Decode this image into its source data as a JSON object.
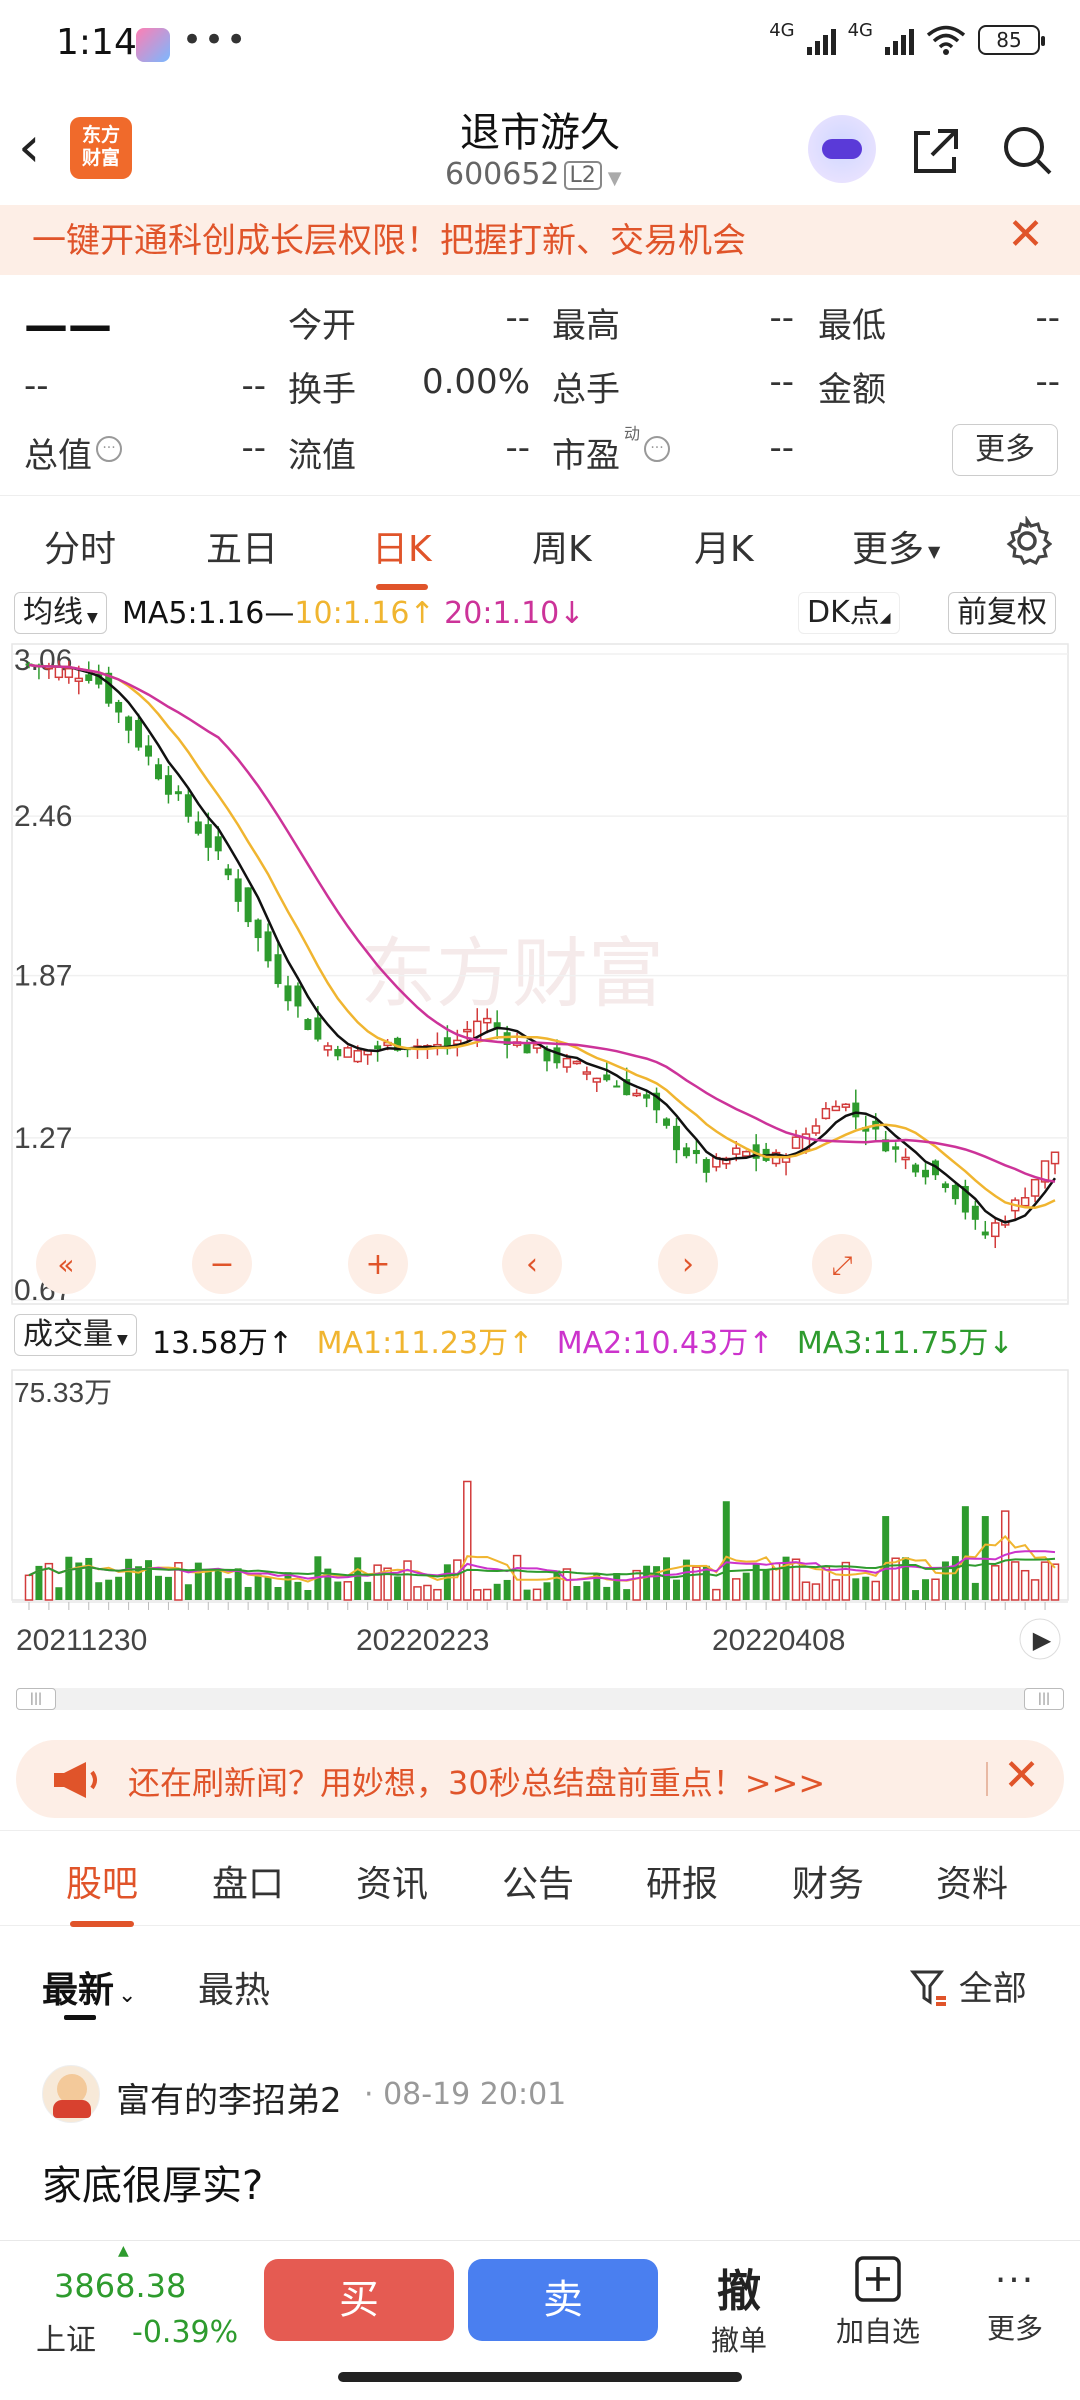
{
  "status_bar": {
    "time": "1:14",
    "dots": "•••",
    "net1": "4G",
    "net2": "4G",
    "battery": "85"
  },
  "header": {
    "title": "退市游久",
    "code": "600652",
    "level": "L2",
    "logo_line1": "东方",
    "logo_line2": "财富"
  },
  "banner": {
    "text": "一键开通科创成长层权限！把握打新、交易机会",
    "close": "✕"
  },
  "quote": {
    "price": "——",
    "change": "--",
    "change_pct": "--",
    "rows": [
      [
        {
          "label": "今开",
          "value": "--"
        },
        {
          "label": "最高",
          "value": "--"
        },
        {
          "label": "最低",
          "value": "--"
        }
      ],
      [
        {
          "label": "换手",
          "value": "0.00%"
        },
        {
          "label": "总手",
          "value": "--"
        },
        {
          "label": "金额",
          "value": "--"
        }
      ],
      [
        {
          "label": "流值",
          "value": "--"
        },
        {
          "label": "市盈",
          "value": "--"
        }
      ]
    ],
    "total_value_label": "总值",
    "total_value": "--",
    "pe_sup": "动",
    "more": "更多"
  },
  "chart_tabs": [
    "分时",
    "五日",
    "日K",
    "周K",
    "月K",
    "更多"
  ],
  "chart_controls": {
    "ma_selector": "均线",
    "ma5": "MA5:1.16",
    "ma10": "10:1.16",
    "ma20": "20:1.10",
    "dk": "DK点",
    "adjust": "前复权",
    "vol_selector": "成交量",
    "vol_now": "13.58万",
    "vol_ma1": "MA1:11.23万",
    "vol_ma2": "MA2:10.43万",
    "vol_ma3": "MA3:11.75万",
    "vol_max": "75.33万"
  },
  "chart_data": {
    "type": "candlestick",
    "y_ticks": [
      "3.06",
      "2.46",
      "1.87",
      "1.27",
      "0.67"
    ],
    "ylim": [
      0.67,
      3.06
    ],
    "x_dates": [
      "20211230",
      "20220223",
      "20220408"
    ],
    "ma_colors": {
      "ma5": "#111111",
      "ma10": "#f0b530",
      "ma20": "#cc3399"
    },
    "up_color": "#d23b3b",
    "down_color": "#2e9b2e",
    "watermark": "东方财富"
  },
  "ad_bar": {
    "text": "还在刷新闻？用妙想，30秒总结盘前重点！>>>",
    "close": "✕"
  },
  "section_tabs": [
    "股吧",
    "盘口",
    "资讯",
    "公告",
    "研报",
    "财务",
    "资料"
  ],
  "filters": {
    "latest": "最新",
    "hot": "最热",
    "all": "全部"
  },
  "post": {
    "author": "富有的李招弟2",
    "time": "· 08-19 20:01",
    "content": "家底很厚实?"
  },
  "bottom": {
    "index_value": "3868.38",
    "index_name": "上证",
    "index_change": "-0.39%",
    "buy": "买",
    "sell": "卖",
    "cancel_icon": "撤",
    "cancel": "撤单",
    "add": "加自选",
    "more": "更多"
  }
}
